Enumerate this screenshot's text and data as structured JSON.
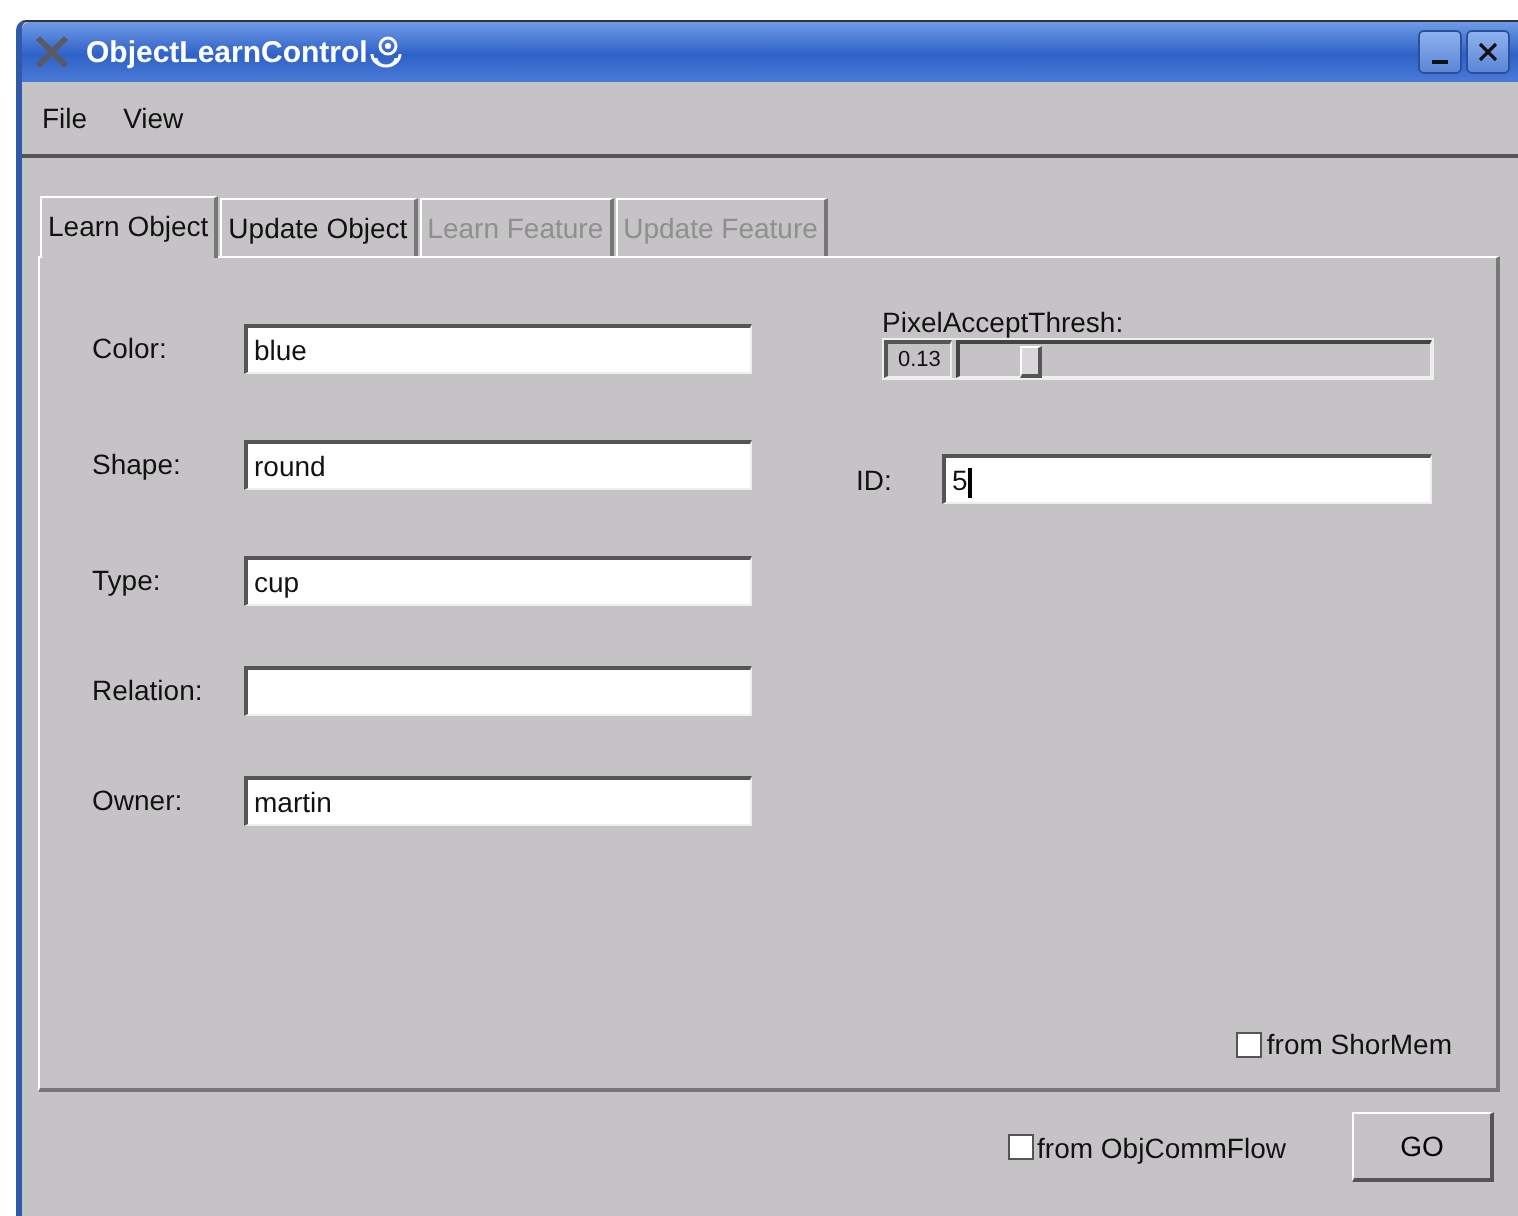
{
  "window": {
    "title": "ObjectLearnControl"
  },
  "menu": [
    "File",
    "View"
  ],
  "tabs": [
    {
      "label": "Learn Object",
      "selected": true,
      "disabled": false
    },
    {
      "label": "Update Object",
      "selected": false,
      "disabled": false
    },
    {
      "label": "Learn Feature",
      "selected": false,
      "disabled": true
    },
    {
      "label": "Update Feature",
      "selected": false,
      "disabled": true
    }
  ],
  "fields": [
    {
      "label": "Color:",
      "value": "blue"
    },
    {
      "label": "Shape:",
      "value": "round"
    },
    {
      "label": "Type:",
      "value": "cup"
    },
    {
      "label": "Relation:"
    },
    {
      "label": "Owner:",
      "value": "martin"
    }
  ],
  "slider": {
    "label": "PixelAcceptThresh:",
    "reading": "0.13",
    "level": 0.15
  },
  "id_field": {
    "label": "ID:",
    "value": "5",
    "focused": true
  },
  "shormem": {
    "label": "from ShorMem",
    "checked": false
  },
  "objcommflow": {
    "label": "from ObjCommFlow",
    "checked": false
  },
  "go_button": "GO"
}
